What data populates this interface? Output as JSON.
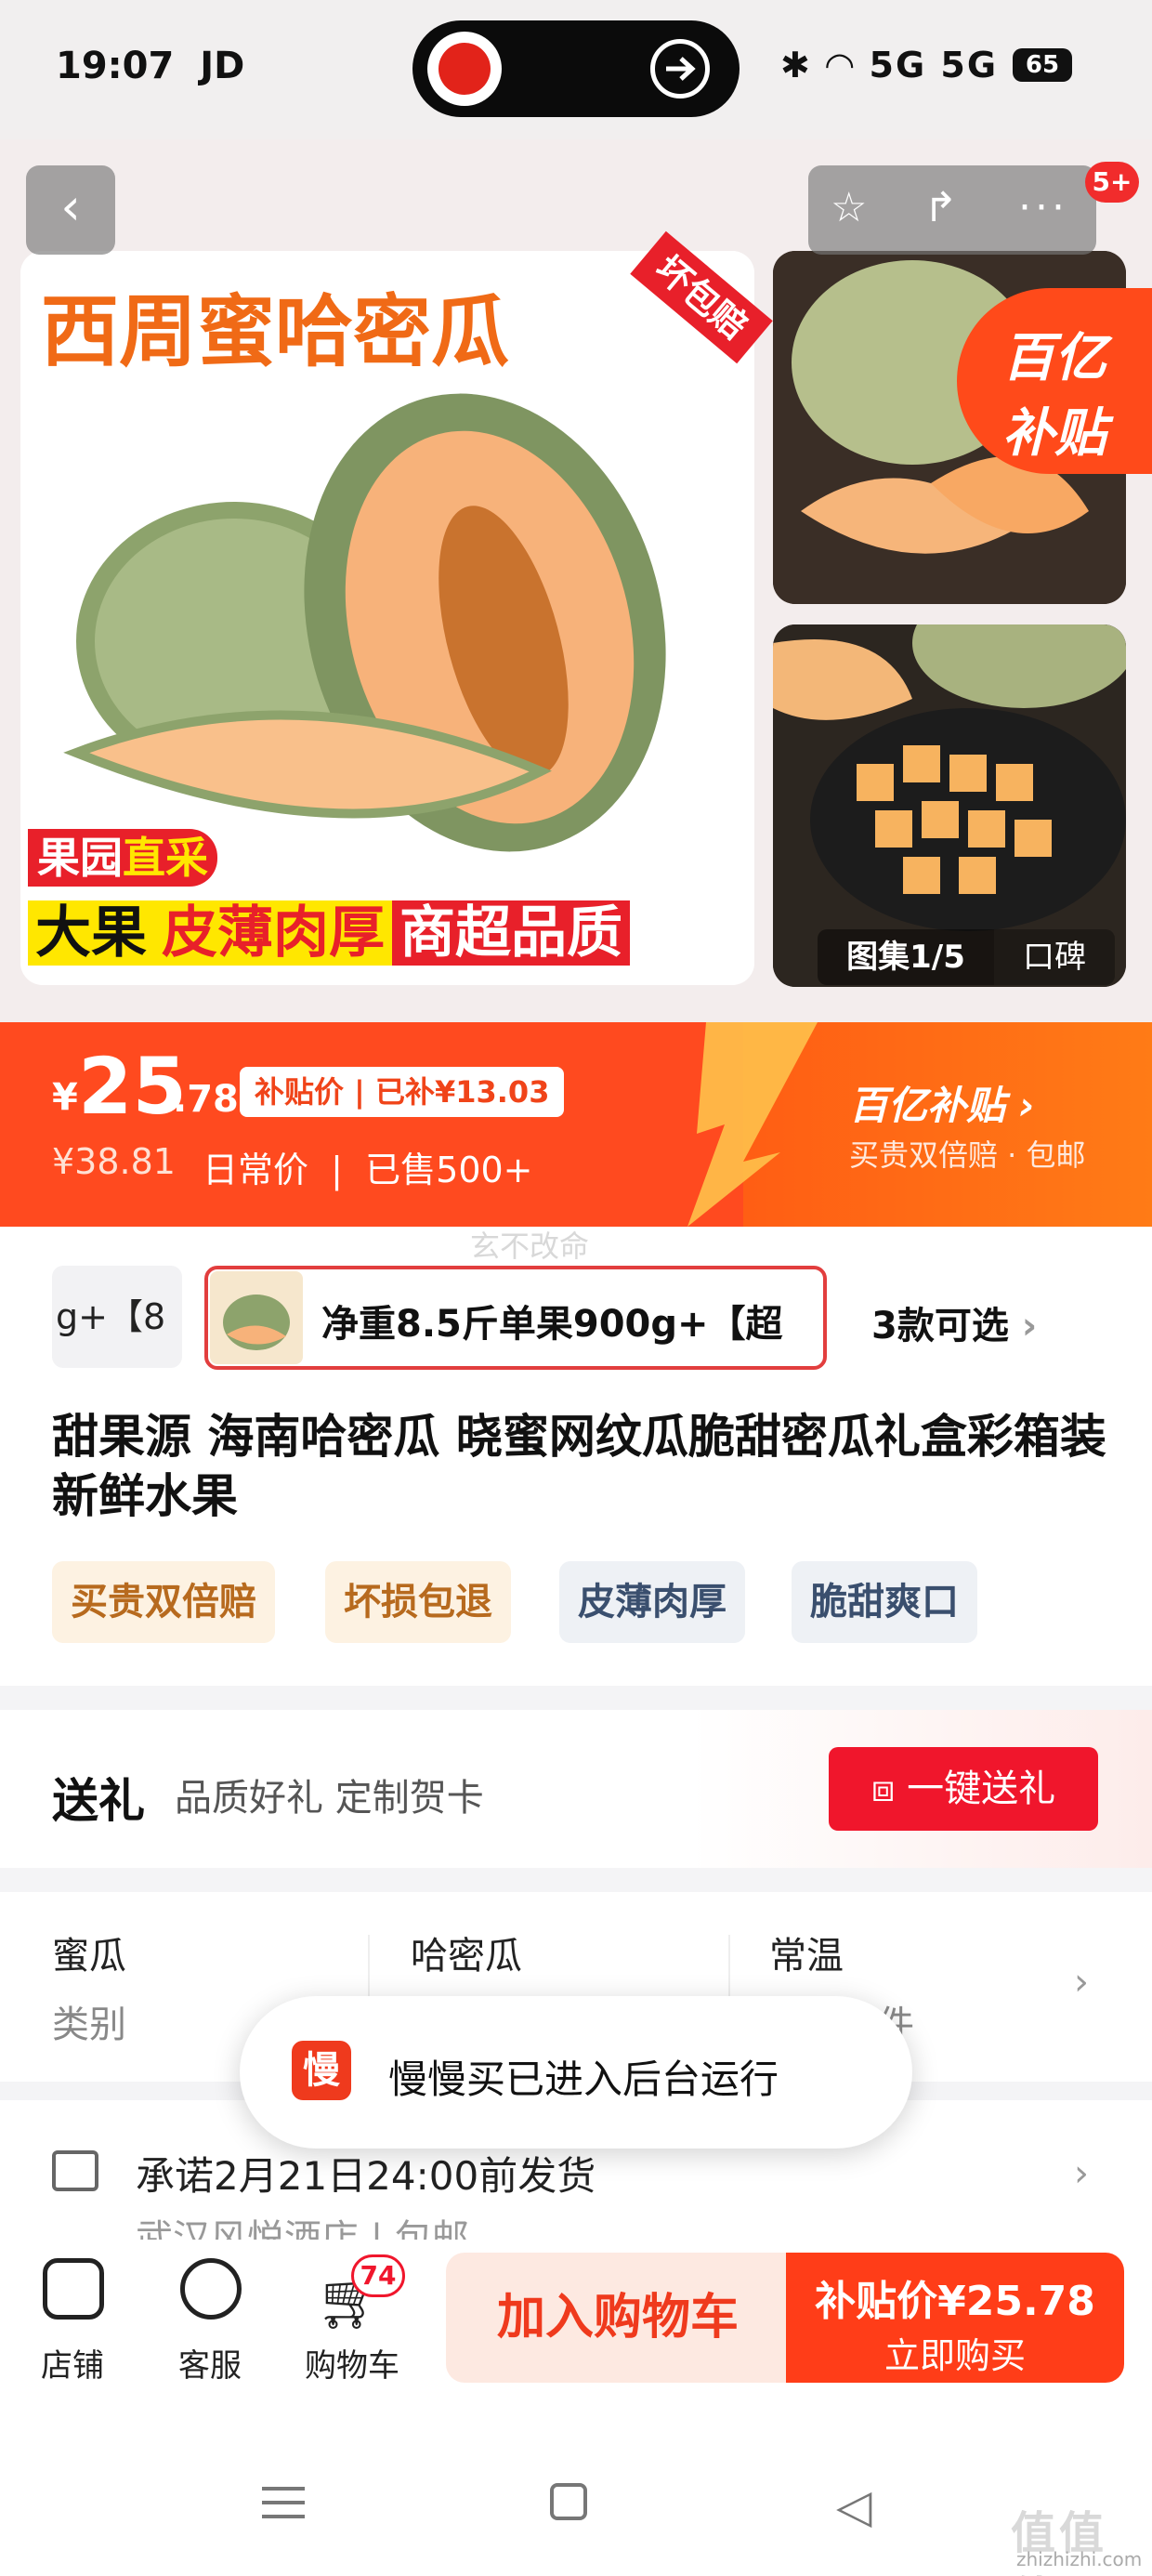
{
  "status_bar": {
    "time": "19:07",
    "carrier": "JD",
    "signal": "5G 5G",
    "battery": "65"
  },
  "gallery": {
    "main_headline": "西周蜜哈密瓜",
    "corner_tag": "坏包赔",
    "promo_1a": "果园",
    "promo_1b": "直采",
    "promo_2a": "大果",
    "promo_2b": "皮薄肉厚",
    "promo_2c": "商超品质",
    "badge_logo": "百亿",
    "badge_text": "补贴",
    "album_label": "图集1/5",
    "review_label": "口碑",
    "notification_badge": "5+"
  },
  "price": {
    "currency": "¥",
    "integer": "25",
    "decimal": ".78",
    "subsidy_tag": "补贴价 | 已补¥13.03",
    "original": "¥38.81",
    "original_label": "日常价",
    "sold": "已售500+",
    "bi_logo": "百亿补贴 ›",
    "bi_sub": "买贵双倍赔 · 包邮"
  },
  "watermark": "玄不改命",
  "variants": {
    "prev_partial": "g+【8",
    "selected_label": "净重8.5斤单果900g+【超",
    "more": "3款可选"
  },
  "product": {
    "title": "甜果源 海南哈密瓜 晓蜜网纹瓜脆甜密瓜礼盒彩箱装 新鲜水果",
    "tags": [
      "买贵双倍赔",
      "坏损包退",
      "皮薄肉厚",
      "脆甜爽口"
    ]
  },
  "gift": {
    "title": "送礼",
    "subtitle": "品质好礼 定制贺卡",
    "button": "一键送礼"
  },
  "attributes": [
    {
      "value": "蜜瓜",
      "key": "类别"
    },
    {
      "value": "哈密瓜",
      "key": ""
    },
    {
      "value": "常温",
      "key": "件"
    }
  ],
  "toast": {
    "icon": "慢",
    "text": "慢慢买已进入后台运行"
  },
  "delivery": {
    "promise": "承诺2月21日24:00前发货",
    "store": "武汉风悦酒店 | 包邮"
  },
  "bottom_bar": {
    "store": "店铺",
    "service": "客服",
    "cart": "购物车",
    "cart_count": "74",
    "add_to_cart": "加入购物车",
    "buy_price": "补贴价¥25.78",
    "buy_now": "立即购买"
  },
  "site_watermark": {
    "brand": "值值值",
    "url": "zhizhizhi.com"
  }
}
